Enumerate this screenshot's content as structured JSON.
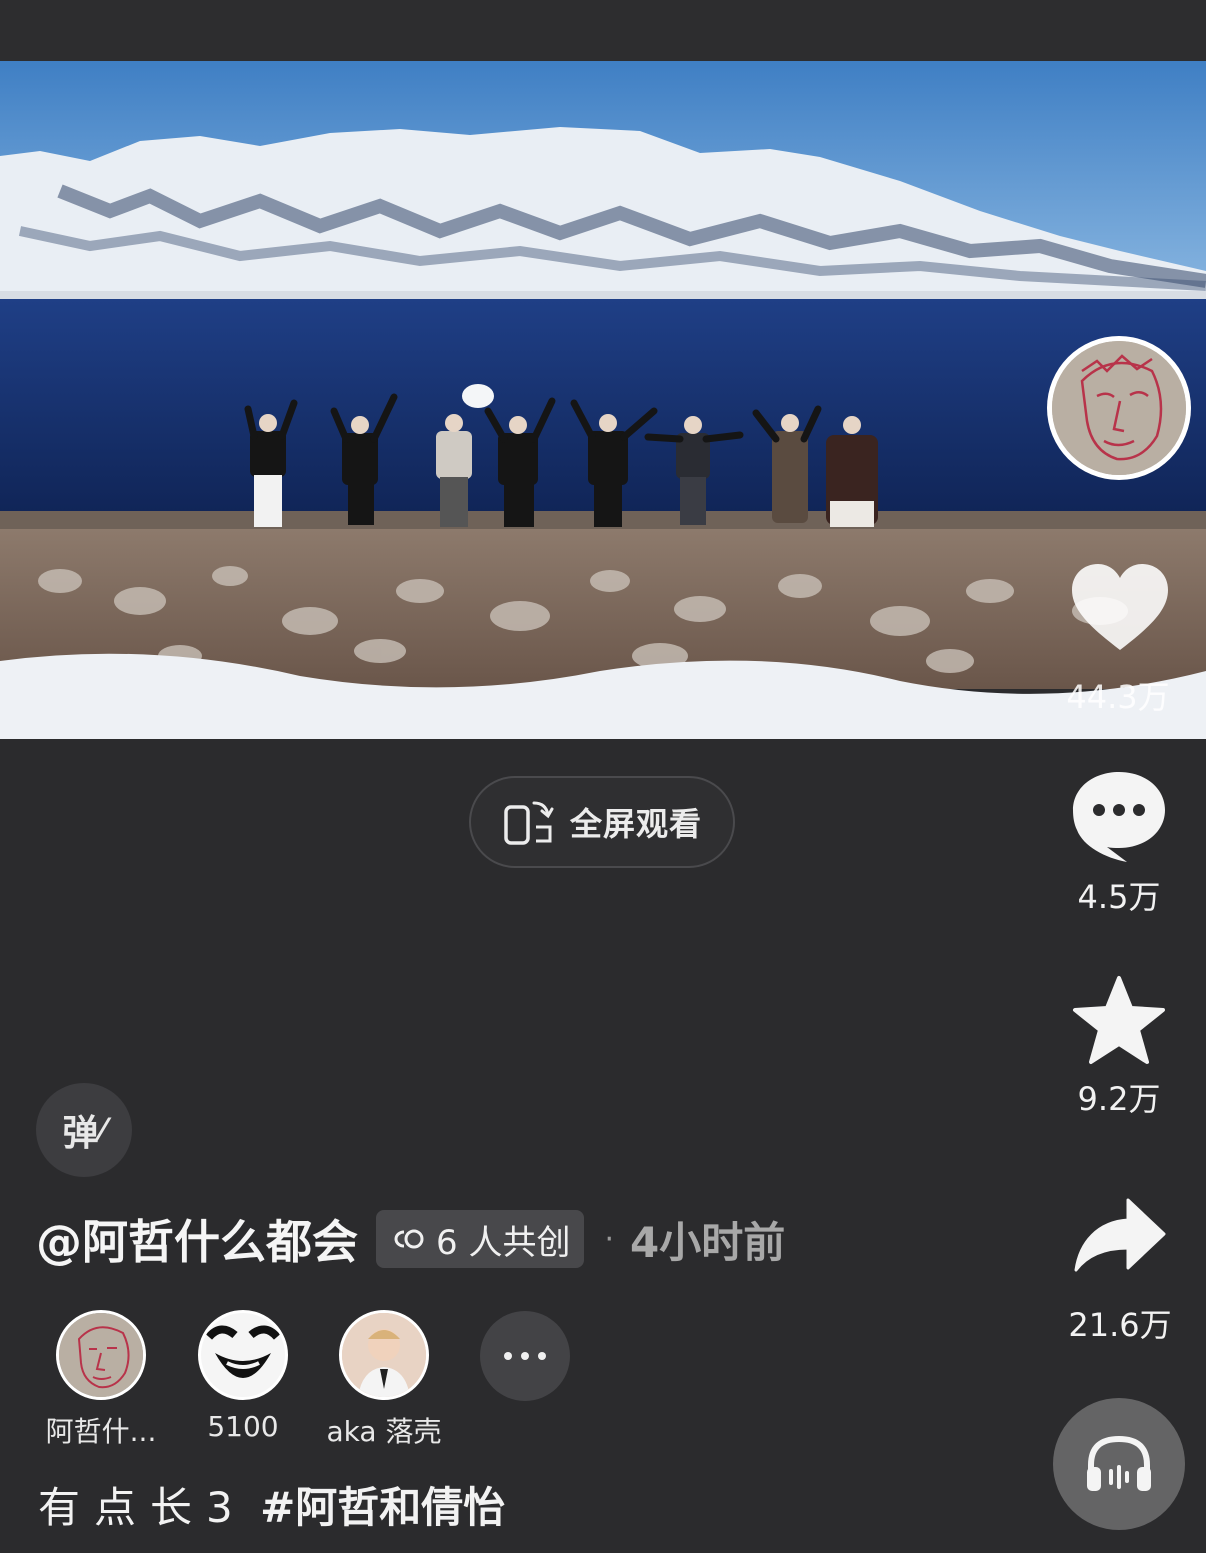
{
  "video": {
    "fullscreen_label": "全屏观看"
  },
  "actions": {
    "like_count": "44.3万",
    "comment_count": "4.5万",
    "favorite_count": "9.2万",
    "share_count": "21.6万"
  },
  "danmu": {
    "label": "弹"
  },
  "post": {
    "author": "@阿哲什么都会",
    "cocreate_label": "6 人共创",
    "separator": "·",
    "time": "4小时前",
    "caption_text": "有点长3",
    "caption_tag": "#阿哲和倩怡"
  },
  "collaborators": [
    {
      "name": "阿哲什..."
    },
    {
      "name": "5100"
    },
    {
      "name": "aka 落壳"
    }
  ],
  "icons": {
    "fullscreen": "phone-rotate-icon",
    "like": "heart-icon",
    "comment": "chat-bubble-icon",
    "favorite": "star-icon",
    "share": "share-arrow-icon",
    "cocreate": "link-icon",
    "more": "ellipsis-icon",
    "listen": "headphones-icon"
  }
}
